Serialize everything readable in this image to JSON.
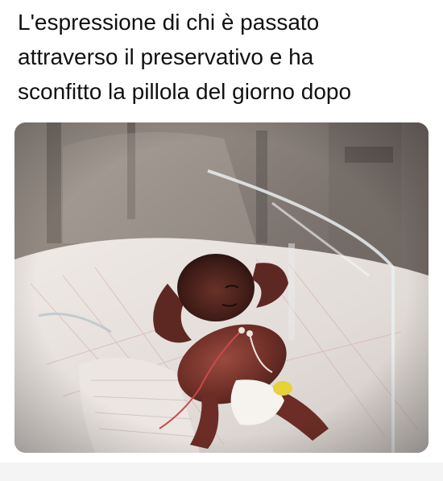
{
  "caption": {
    "lines": [
      "L'espressione di chi è passato",
      "attraverso il preservativo e ha",
      "sconfitto la pillola del giorno dopo"
    ]
  },
  "photo": {
    "subject_icon": "newborn-in-incubator-photo"
  },
  "colors": {
    "background": "#ffffff",
    "text": "#111111"
  }
}
